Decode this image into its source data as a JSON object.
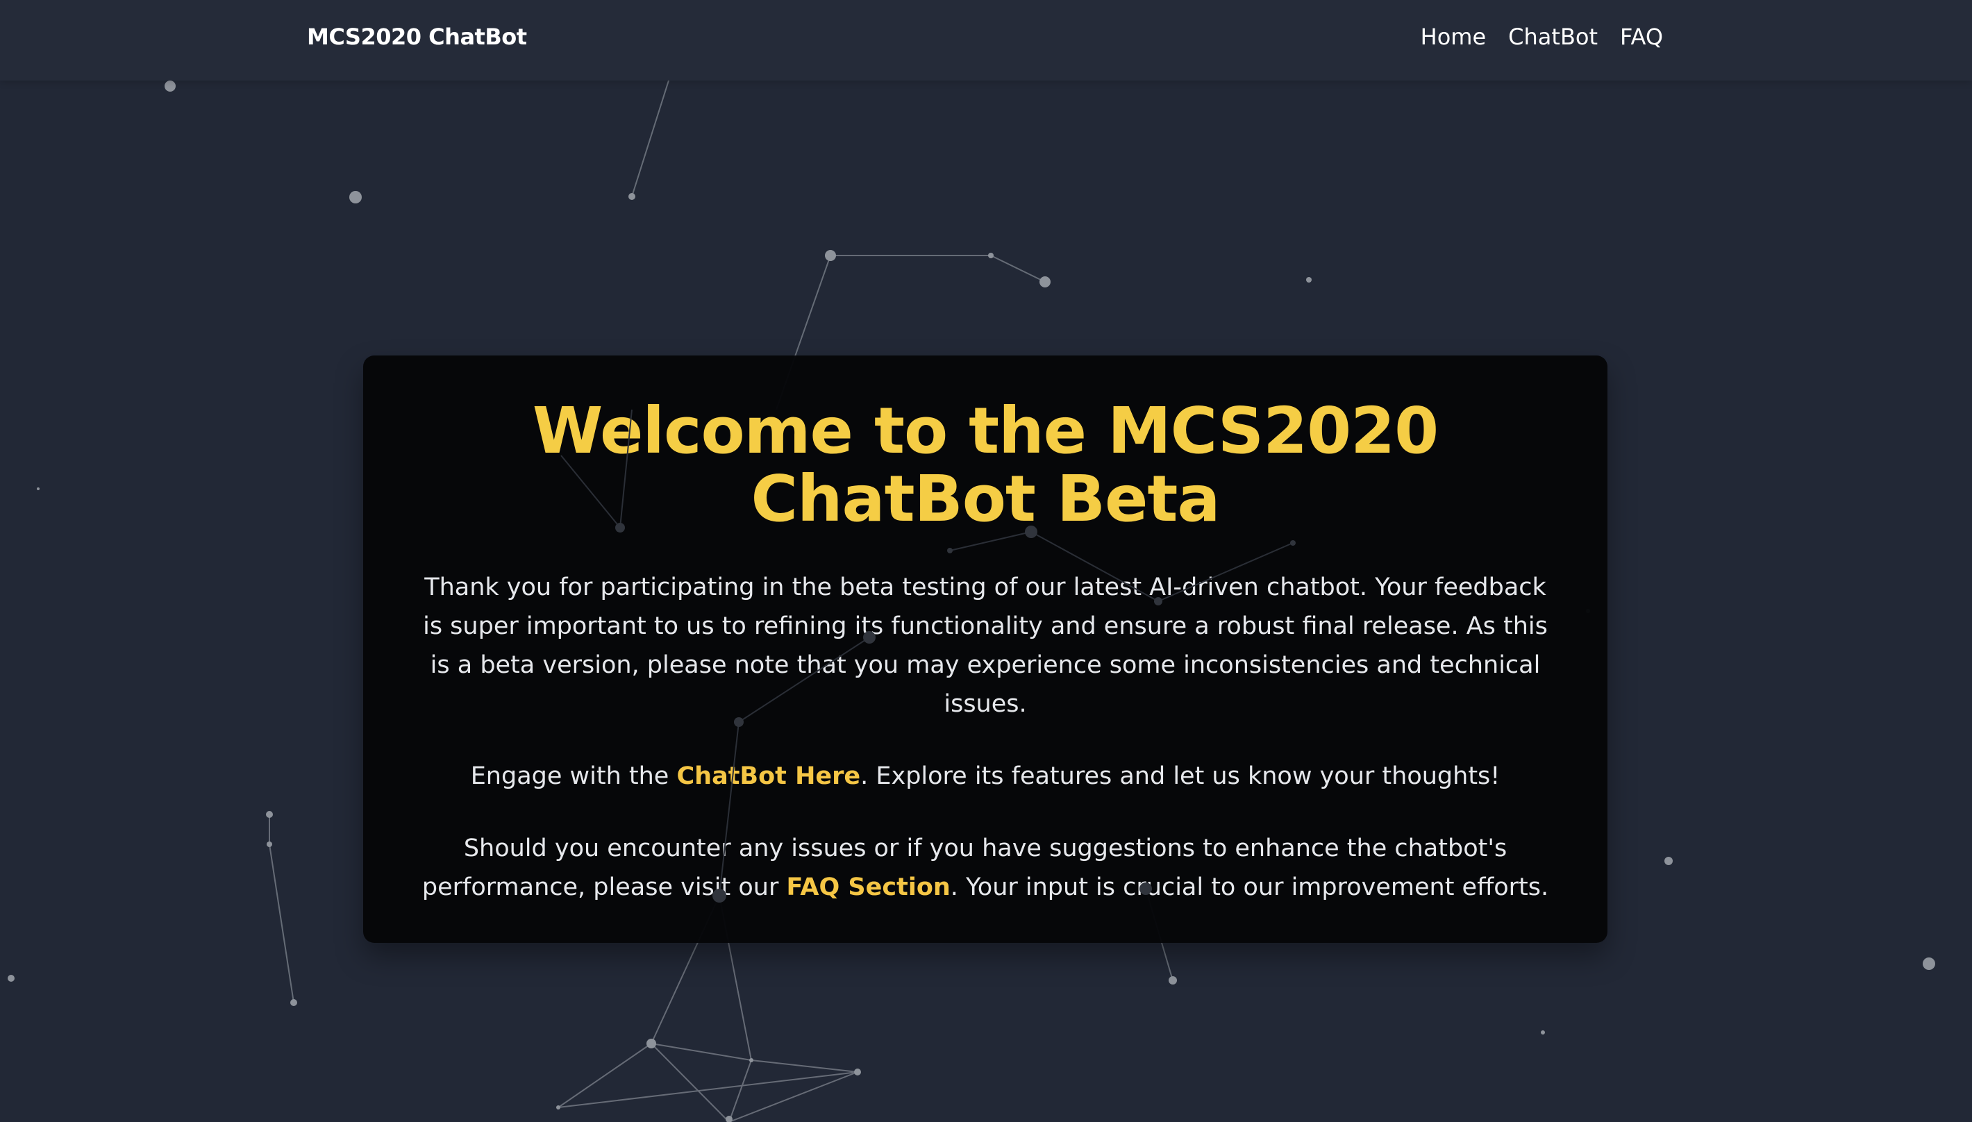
{
  "navbar": {
    "brand": "MCS2020 ChatBot",
    "links": [
      {
        "label": "Home"
      },
      {
        "label": "ChatBot"
      },
      {
        "label": "FAQ"
      }
    ]
  },
  "card": {
    "title": "Welcome to the MCS2020 ChatBot Beta",
    "intro": "Thank you for participating in the beta testing of our latest AI-driven chatbot. Your feedback is super important to us to refining its functionality and ensure a robust final release. As this is a beta version, please note that you may experience some inconsistencies and technical issues.",
    "engage_prefix": "Engage with the ",
    "engage_link": "ChatBot Here",
    "engage_suffix": ". Explore its features and let us know your thoughts!",
    "issues_prefix": "Should you encounter any issues or if you have suggestions to enhance the chatbot's performance, please visit our ",
    "issues_link": "FAQ Section",
    "issues_suffix": ". Your input is crucial to our improvement efforts."
  },
  "colors": {
    "background": "#222836",
    "navbar": "#252b39",
    "card": "#050608",
    "accent": "#f5cd45",
    "text": "#e6e8ec"
  }
}
